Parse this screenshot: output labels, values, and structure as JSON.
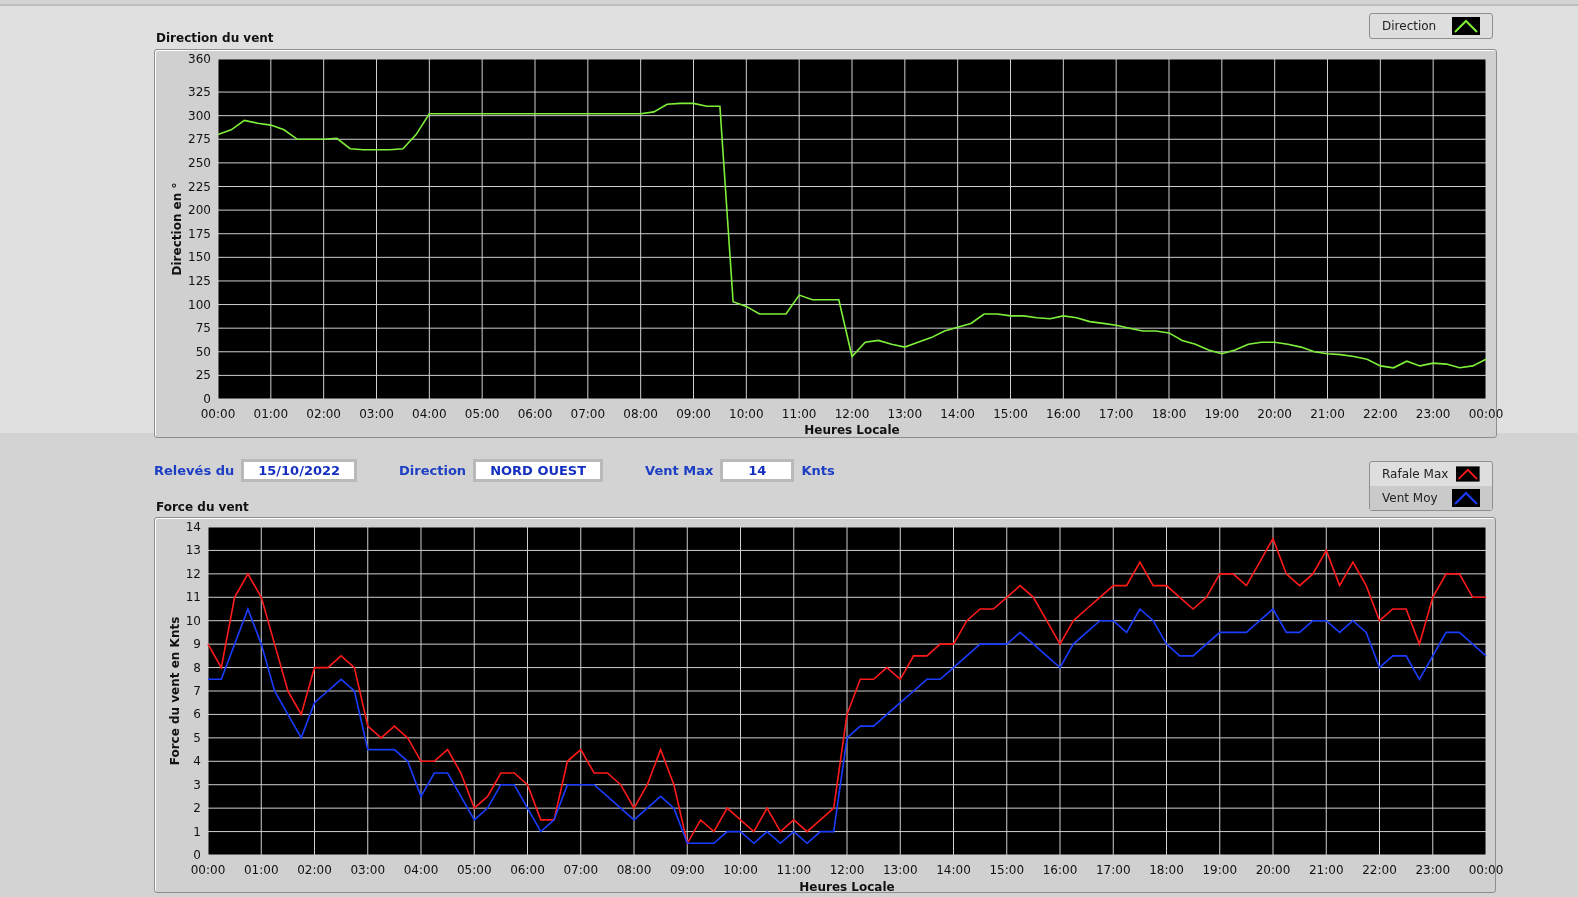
{
  "direction_chart": {
    "chart_data": {
      "type": "line",
      "grid": true,
      "title": "Direction du vent",
      "xlabel": "Heures Locale",
      "ylabel": "Direction en °",
      "x": [
        0,
        0.25,
        0.5,
        0.75,
        1,
        1.25,
        1.5,
        1.75,
        2,
        2.25,
        2.5,
        2.75,
        3,
        3.25,
        3.5,
        3.75,
        4,
        4.25,
        4.5,
        4.75,
        5,
        5.25,
        5.5,
        5.75,
        6,
        6.25,
        6.5,
        6.75,
        7,
        7.25,
        7.5,
        7.75,
        8,
        8.25,
        8.5,
        8.75,
        9,
        9.25,
        9.5,
        9.75,
        10,
        10.25,
        10.5,
        10.75,
        11,
        11.25,
        11.5,
        11.75,
        12,
        12.25,
        12.5,
        12.75,
        13,
        13.25,
        13.5,
        13.75,
        14,
        14.25,
        14.5,
        14.75,
        15,
        15.25,
        15.5,
        15.75,
        16,
        16.25,
        16.5,
        16.75,
        17,
        17.25,
        17.5,
        17.75,
        18,
        18.25,
        18.5,
        18.75,
        19,
        19.25,
        19.5,
        19.75,
        20,
        20.25,
        20.5,
        20.75,
        21,
        21.25,
        21.5,
        21.75,
        22,
        22.25,
        22.5,
        22.75,
        23,
        23.25,
        23.5,
        23.75,
        24
      ],
      "series": [
        {
          "name": "Direction",
          "color": "#7ff03a",
          "values": [
            280,
            285,
            295,
            292,
            290,
            285,
            275,
            275,
            275,
            276,
            265,
            264,
            264,
            264,
            265,
            280,
            302,
            302,
            302,
            302,
            302,
            302,
            302,
            302,
            302,
            302,
            302,
            302,
            302,
            302,
            302,
            302,
            302,
            304,
            312,
            313,
            313,
            310,
            310,
            103,
            98,
            90,
            90,
            90,
            110,
            105,
            105,
            105,
            45,
            60,
            62,
            58,
            55,
            60,
            65,
            72,
            76,
            80,
            90,
            90,
            88,
            88,
            86,
            85,
            88,
            86,
            82,
            80,
            78,
            75,
            72,
            72,
            70,
            62,
            58,
            52,
            48,
            52,
            58,
            60,
            60,
            58,
            55,
            50,
            48,
            47,
            45,
            42,
            35,
            33,
            40,
            35,
            38,
            37,
            33,
            35,
            42
          ]
        }
      ],
      "xlim": [
        0,
        24
      ],
      "ylim": [
        0,
        360
      ],
      "xticks": [
        {
          "value": 0,
          "label": "00:00"
        },
        {
          "value": 1,
          "label": "01:00"
        },
        {
          "value": 2,
          "label": "02:00"
        },
        {
          "value": 3,
          "label": "03:00"
        },
        {
          "value": 4,
          "label": "04:00"
        },
        {
          "value": 5,
          "label": "05:00"
        },
        {
          "value": 6,
          "label": "06:00"
        },
        {
          "value": 7,
          "label": "07:00"
        },
        {
          "value": 8,
          "label": "08:00"
        },
        {
          "value": 9,
          "label": "09:00"
        },
        {
          "value": 10,
          "label": "10:00"
        },
        {
          "value": 11,
          "label": "11:00"
        },
        {
          "value": 12,
          "label": "12:00"
        },
        {
          "value": 13,
          "label": "13:00"
        },
        {
          "value": 14,
          "label": "14:00"
        },
        {
          "value": 15,
          "label": "15:00"
        },
        {
          "value": 16,
          "label": "16:00"
        },
        {
          "value": 17,
          "label": "17:00"
        },
        {
          "value": 18,
          "label": "18:00"
        },
        {
          "value": 19,
          "label": "19:00"
        },
        {
          "value": 20,
          "label": "20:00"
        },
        {
          "value": 21,
          "label": "21:00"
        },
        {
          "value": 22,
          "label": "22:00"
        },
        {
          "value": 23,
          "label": "23:00"
        },
        {
          "value": 24,
          "label": "00:00"
        }
      ],
      "yticks": [
        0,
        25,
        50,
        75,
        100,
        125,
        150,
        175,
        200,
        225,
        250,
        275,
        300,
        325,
        360
      ]
    }
  },
  "readings": [
    {
      "label": "Relevés du",
      "value": "15/10/2022"
    },
    {
      "label": "Direction",
      "value": "NORD OUEST"
    },
    {
      "label": "Vent Max",
      "value": "14",
      "unit": "Knts"
    }
  ],
  "force_chart": {
    "chart_data": {
      "type": "line",
      "grid": true,
      "title": "Force du vent",
      "xlabel": "Heures Locale",
      "ylabel": "Force du vent en Knts",
      "x": [
        0,
        0.25,
        0.5,
        0.75,
        1,
        1.25,
        1.5,
        1.75,
        2,
        2.25,
        2.5,
        2.75,
        3,
        3.25,
        3.5,
        3.75,
        4,
        4.25,
        4.5,
        4.75,
        5,
        5.25,
        5.5,
        5.75,
        6,
        6.25,
        6.5,
        6.75,
        7,
        7.25,
        7.5,
        7.75,
        8,
        8.25,
        8.5,
        8.75,
        9,
        9.25,
        9.5,
        9.75,
        10,
        10.25,
        10.5,
        10.75,
        11,
        11.25,
        11.5,
        11.75,
        12,
        12.25,
        12.5,
        12.75,
        13,
        13.25,
        13.5,
        13.75,
        14,
        14.25,
        14.5,
        14.75,
        15,
        15.25,
        15.5,
        15.75,
        16,
        16.25,
        16.5,
        16.75,
        17,
        17.25,
        17.5,
        17.75,
        18,
        18.25,
        18.5,
        18.75,
        19,
        19.25,
        19.5,
        19.75,
        20,
        20.25,
        20.5,
        20.75,
        21,
        21.25,
        21.5,
        21.75,
        22,
        22.25,
        22.5,
        22.75,
        23,
        23.25,
        23.5,
        23.75,
        24
      ],
      "series": [
        {
          "name": "Rafale Max",
          "color": "#ff1a1a",
          "values": [
            9,
            8,
            11,
            12,
            11,
            9,
            7,
            6,
            8,
            8,
            8.5,
            8,
            5.5,
            5,
            5.5,
            5,
            4,
            4,
            4.5,
            3.5,
            2,
            2.5,
            3.5,
            3.5,
            3,
            1.5,
            1.5,
            4,
            4.5,
            3.5,
            3.5,
            3,
            2,
            3,
            4.5,
            3,
            0.5,
            1.5,
            1,
            2,
            1.5,
            1,
            2,
            1,
            1.5,
            1,
            1.5,
            2,
            6,
            7.5,
            7.5,
            8,
            7.5,
            8.5,
            8.5,
            9,
            9,
            10,
            10.5,
            10.5,
            11,
            11.5,
            11,
            10,
            9,
            10,
            10.5,
            11,
            11.5,
            11.5,
            12.5,
            11.5,
            11.5,
            11,
            10.5,
            11,
            12,
            12,
            11.5,
            12.5,
            13.5,
            12,
            11.5,
            12,
            13,
            11.5,
            12.5,
            11.5,
            10,
            10.5,
            10.5,
            9,
            11,
            12,
            12,
            11,
            11
          ]
        },
        {
          "name": "Vent Moy",
          "color": "#1a3cff",
          "values": [
            7.5,
            7.5,
            9,
            10.5,
            9,
            7,
            6,
            5,
            6.5,
            7,
            7.5,
            7,
            4.5,
            4.5,
            4.5,
            4,
            2.5,
            3.5,
            3.5,
            2.5,
            1.5,
            2,
            3,
            3,
            2,
            1,
            1.5,
            3,
            3,
            3,
            2.5,
            2,
            1.5,
            2,
            2.5,
            2,
            0.5,
            0.5,
            0.5,
            1,
            1,
            0.5,
            1,
            0.5,
            1,
            0.5,
            1,
            1,
            5,
            5.5,
            5.5,
            6,
            6.5,
            7,
            7.5,
            7.5,
            8,
            8.5,
            9,
            9,
            9,
            9.5,
            9,
            8.5,
            8,
            9,
            9.5,
            10,
            10,
            9.5,
            10.5,
            10,
            9,
            8.5,
            8.5,
            9,
            9.5,
            9.5,
            9.5,
            10,
            10.5,
            9.5,
            9.5,
            10,
            10,
            9.5,
            10,
            9.5,
            8,
            8.5,
            8.5,
            7.5,
            8.5,
            9.5,
            9.5,
            9,
            8.5
          ]
        }
      ],
      "xlim": [
        0,
        24
      ],
      "ylim": [
        0,
        14
      ],
      "xticks": [
        {
          "value": 0,
          "label": "00:00"
        },
        {
          "value": 1,
          "label": "01:00"
        },
        {
          "value": 2,
          "label": "02:00"
        },
        {
          "value": 3,
          "label": "03:00"
        },
        {
          "value": 4,
          "label": "04:00"
        },
        {
          "value": 5,
          "label": "05:00"
        },
        {
          "value": 6,
          "label": "06:00"
        },
        {
          "value": 7,
          "label": "07:00"
        },
        {
          "value": 8,
          "label": "08:00"
        },
        {
          "value": 9,
          "label": "09:00"
        },
        {
          "value": 10,
          "label": "10:00"
        },
        {
          "value": 11,
          "label": "11:00"
        },
        {
          "value": 12,
          "label": "12:00"
        },
        {
          "value": 13,
          "label": "13:00"
        },
        {
          "value": 14,
          "label": "14:00"
        },
        {
          "value": 15,
          "label": "15:00"
        },
        {
          "value": 16,
          "label": "16:00"
        },
        {
          "value": 17,
          "label": "17:00"
        },
        {
          "value": 18,
          "label": "18:00"
        },
        {
          "value": 19,
          "label": "19:00"
        },
        {
          "value": 20,
          "label": "20:00"
        },
        {
          "value": 21,
          "label": "21:00"
        },
        {
          "value": 22,
          "label": "22:00"
        },
        {
          "value": 23,
          "label": "23:00"
        },
        {
          "value": 24,
          "label": "00:00"
        }
      ],
      "yticks": [
        0,
        1,
        2,
        3,
        4,
        5,
        6,
        7,
        8,
        9,
        10,
        11,
        12,
        13,
        14
      ]
    }
  }
}
